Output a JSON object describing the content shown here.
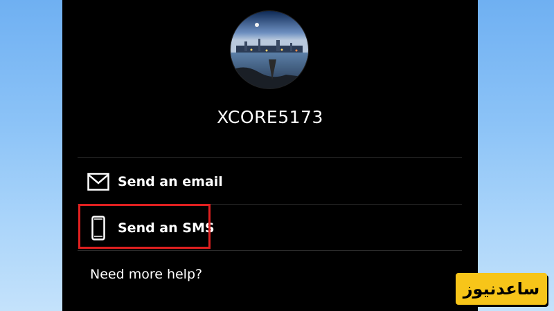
{
  "profile": {
    "username": "XCORE5173"
  },
  "options": [
    {
      "label": "Send an email",
      "icon": "envelope-icon"
    },
    {
      "label": "Send an SMS",
      "icon": "phone-icon"
    }
  ],
  "help": {
    "label": "Need more help?"
  },
  "watermark": {
    "text": "ساعدنیوز"
  },
  "colors": {
    "panel": "#000000",
    "highlight": "#e02020",
    "watermark_bg": "#f7c519"
  }
}
